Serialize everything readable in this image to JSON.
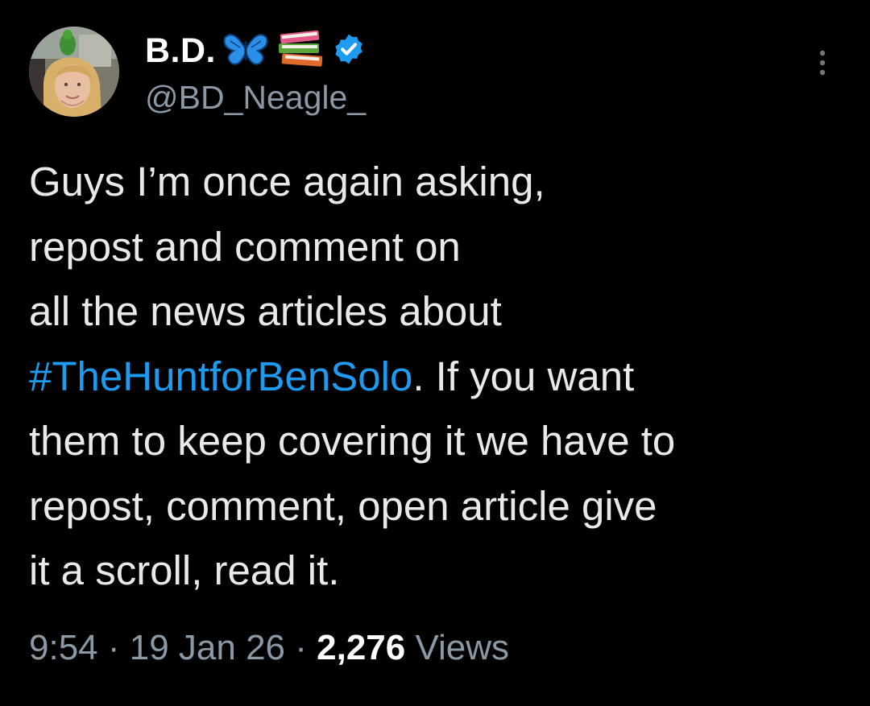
{
  "author": {
    "display_name": "B.D.",
    "name_emojis": [
      "butterfly-emoji",
      "books-emoji"
    ],
    "verified": true,
    "handle": "@BD_Neagle_"
  },
  "tweet": {
    "line1": "Guys I’m once again asking,",
    "line2": "repost and comment on",
    "line3": "all the news articles about",
    "hashtag": "#TheHuntforBenSolo",
    "line4_rest": ". If you want",
    "line5": "them to keep covering it we have to",
    "line6": "repost, comment, open article give",
    "line7": "it a scroll, read it."
  },
  "meta": {
    "time": "9:54",
    "sep1": " · ",
    "date": "19 Jan 26",
    "sep2": " · ",
    "views_count": "2,276",
    "views_label": " Views"
  },
  "colors": {
    "background": "#000000",
    "text": "#e7e9ea",
    "secondary": "#8b98a5",
    "link": "#1d9bf0",
    "verified": "#1d9bf0"
  },
  "icons": {
    "more": "more-vertical-icon",
    "verified": "verified-badge-icon"
  }
}
